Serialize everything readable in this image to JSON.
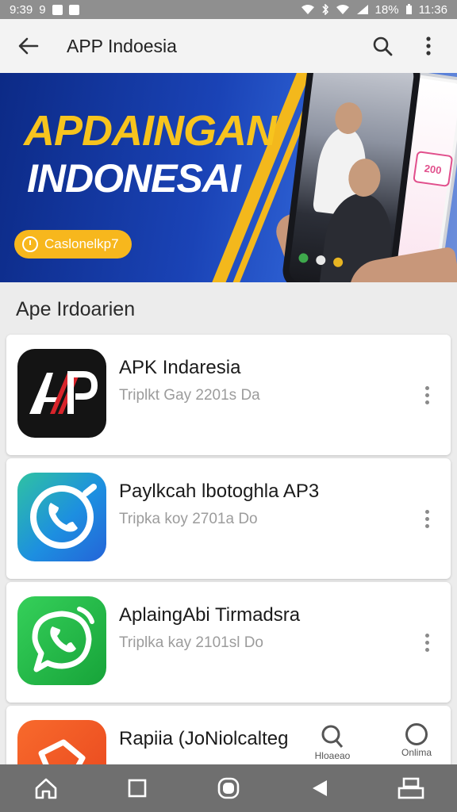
{
  "status_bar": {
    "time_left": "9:39",
    "left_digit": "9",
    "battery": "18%",
    "time_right": "11:36"
  },
  "app_bar": {
    "title": "APP Indoesia"
  },
  "banner": {
    "headline_1": "APDAINGAN",
    "headline_2": "INDONESAI",
    "cta_label": "Caslonelkp7",
    "phone_badge": "200"
  },
  "section": {
    "title": "Ape Irdoarien"
  },
  "apps": [
    {
      "name": "APK Indaresia",
      "subtitle": "Triplkt  Gay 2201s Da",
      "icon": "ap-logo-icon"
    },
    {
      "name": "Paylkcah lbotoghla AP3",
      "subtitle": "Tripka koy 2701a Do",
      "icon": "phone-call-icon"
    },
    {
      "name": "AplaingAbi Tirmadsra",
      "subtitle": "Triplka kay 2101sl Do",
      "icon": "whatsapp-icon"
    },
    {
      "name": "Rapiia (JoNiolcalteg",
      "subtitle": "",
      "icon": "game-controller-icon"
    }
  ],
  "float_tabs": [
    {
      "label": "Hloaeao"
    },
    {
      "label": "Onlima"
    }
  ],
  "colors": {
    "banner_blue": "#1a43b6",
    "banner_yellow": "#f7c41e",
    "nav_gray": "#6f6f6f"
  }
}
